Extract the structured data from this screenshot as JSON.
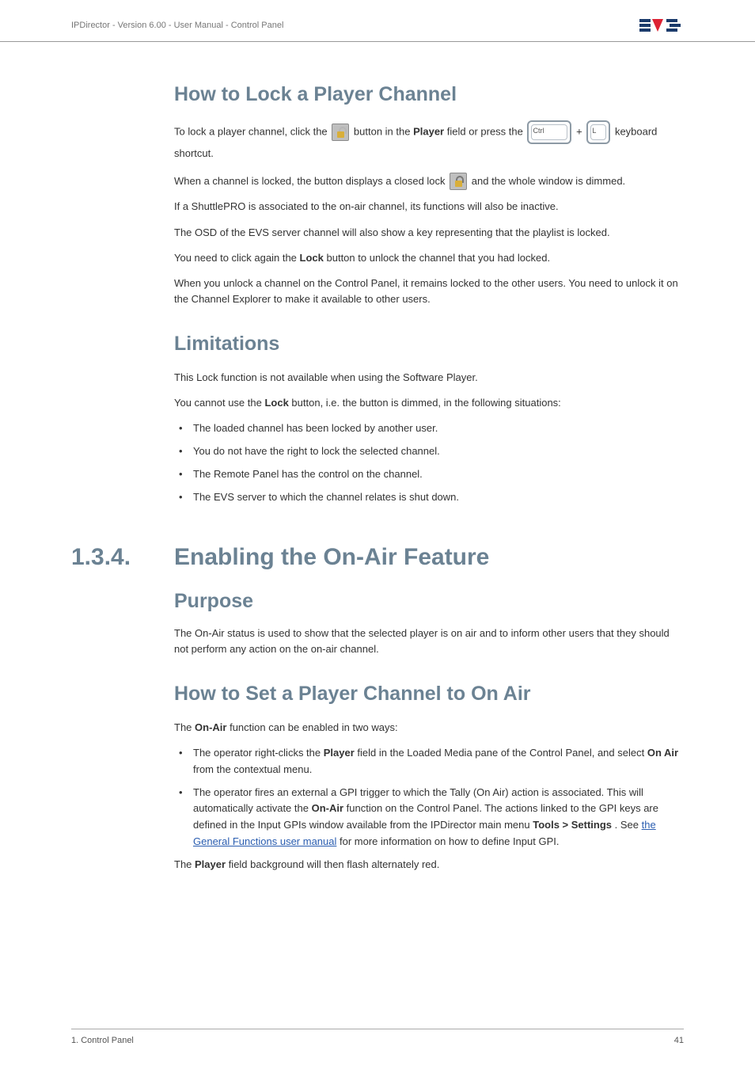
{
  "header": {
    "breadcrumb": "IPDirector - Version 6.00 - User Manual - Control Panel"
  },
  "h_lock": "How to Lock a Player Channel",
  "lock_p1a": "To lock a player channel, click the ",
  "lock_p1b": " button in the ",
  "lock_p1c": "Player",
  "lock_p1d": " field or press the ",
  "lock_p1e": " + ",
  "lock_p1f": " keyboard shortcut.",
  "key_ctrl": "Ctrl",
  "key_l": "L",
  "lock_p2a": "When a channel is locked, the button displays a closed lock ",
  "lock_p2b": " and the whole window is dimmed.",
  "lock_p3": "If a ShuttlePRO is associated to the on-air channel, its functions will also be inactive.",
  "lock_p4": "The OSD of the EVS server channel will also show a key representing that the playlist is locked.",
  "lock_p5a": "You need to click again the ",
  "lock_p5b": "Lock",
  "lock_p5c": " button to unlock the channel that you had locked.",
  "lock_p6": "When you unlock a channel on the Control Panel, it remains locked to the other users. You need to unlock it on the Channel Explorer to make it available to other users.",
  "h_lim": "Limitations",
  "lim_p1": "This Lock function is not available when using the Software Player.",
  "lim_p2a": "You cannot use the ",
  "lim_p2b": "Lock",
  "lim_p2c": " button, i.e. the button is dimmed, in the following situations:",
  "lim_items": [
    "The loaded channel has been locked by another user.",
    "You do not have the right to lock the selected channel.",
    "The Remote Panel has the control on the channel.",
    "The EVS server to which the channel relates is shut down."
  ],
  "sec_num": "1.3.4.",
  "sec_title": "Enabling the On-Air Feature",
  "h_purpose": "Purpose",
  "purpose_p": "The On-Air status is used to show that the selected player is on air and to inform other users that they should not perform any action on the on-air channel.",
  "h_howset": "How to Set a Player Channel to On Air",
  "howset_p1a": "The ",
  "howset_p1b": "On-Air",
  "howset_p1c": " function can be enabled in two ways:",
  "howset_b1a": "The operator right-clicks the ",
  "howset_b1b": "Player",
  "howset_b1c": " field in the Loaded Media pane of the Control Panel, and select ",
  "howset_b1d": "On Air",
  "howset_b1e": " from the contextual menu.",
  "howset_b2a": "The operator fires an external a GPI trigger to which the Tally (On Air) action is associated. This will automatically activate the ",
  "howset_b2b": "On-Air",
  "howset_b2c": " function on the Control Panel. The actions linked to the GPI keys are defined in the Input GPIs window available from the IPDirector main menu ",
  "howset_b2d": "Tools > Settings",
  "howset_b2e": ". See ",
  "howset_b2link": "the General Functions user manual",
  "howset_b2f": " for more information on how to define Input GPI.",
  "howset_p2a": "The ",
  "howset_p2b": "Player",
  "howset_p2c": " field background will then flash alternately red.",
  "footer": {
    "left": "1. Control Panel",
    "right": "41"
  }
}
